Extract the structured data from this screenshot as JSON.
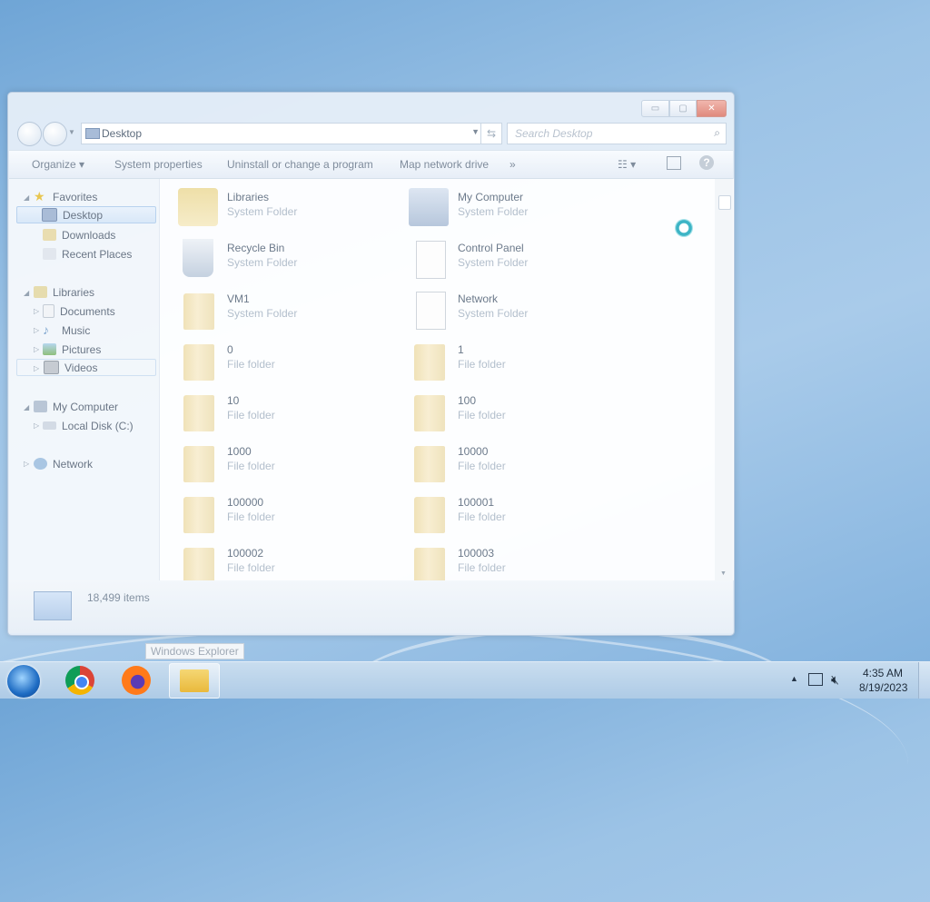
{
  "window": {
    "address": "Desktop",
    "search_placeholder": "Search Desktop",
    "caption": {
      "min": "▭",
      "max": "▢",
      "close": "✕"
    }
  },
  "toolbar": {
    "organize": "Organize ▾",
    "system_properties": "System properties",
    "uninstall": "Uninstall or change a program",
    "map_drive": "Map network drive",
    "more": "»"
  },
  "nav": {
    "favorites": "Favorites",
    "desktop": "Desktop",
    "downloads": "Downloads",
    "recent": "Recent Places",
    "libraries": "Libraries",
    "documents": "Documents",
    "music": "Music",
    "pictures": "Pictures",
    "videos": "Videos",
    "computer": "My Computer",
    "localdisk": "Local Disk (C:)",
    "network": "Network"
  },
  "items": [
    {
      "name": "Libraries",
      "type": "System Folder"
    },
    {
      "name": "My Computer",
      "type": "System Folder"
    },
    {
      "name": "Recycle Bin",
      "type": "System Folder"
    },
    {
      "name": "Control Panel",
      "type": "System Folder"
    },
    {
      "name": "VM1",
      "type": "System Folder"
    },
    {
      "name": "Network",
      "type": "System Folder"
    },
    {
      "name": "0",
      "type": "File folder"
    },
    {
      "name": "1",
      "type": "File folder"
    },
    {
      "name": "10",
      "type": "File folder"
    },
    {
      "name": "100",
      "type": "File folder"
    },
    {
      "name": "1000",
      "type": "File folder"
    },
    {
      "name": "10000",
      "type": "File folder"
    },
    {
      "name": "100000",
      "type": "File folder"
    },
    {
      "name": "100001",
      "type": "File folder"
    },
    {
      "name": "100002",
      "type": "File folder"
    },
    {
      "name": "100003",
      "type": "File folder"
    }
  ],
  "details": {
    "count": "18,499 items"
  },
  "tooltip": "Windows Explorer",
  "tray": {
    "time": "4:35 AM",
    "date": "8/19/2023"
  }
}
